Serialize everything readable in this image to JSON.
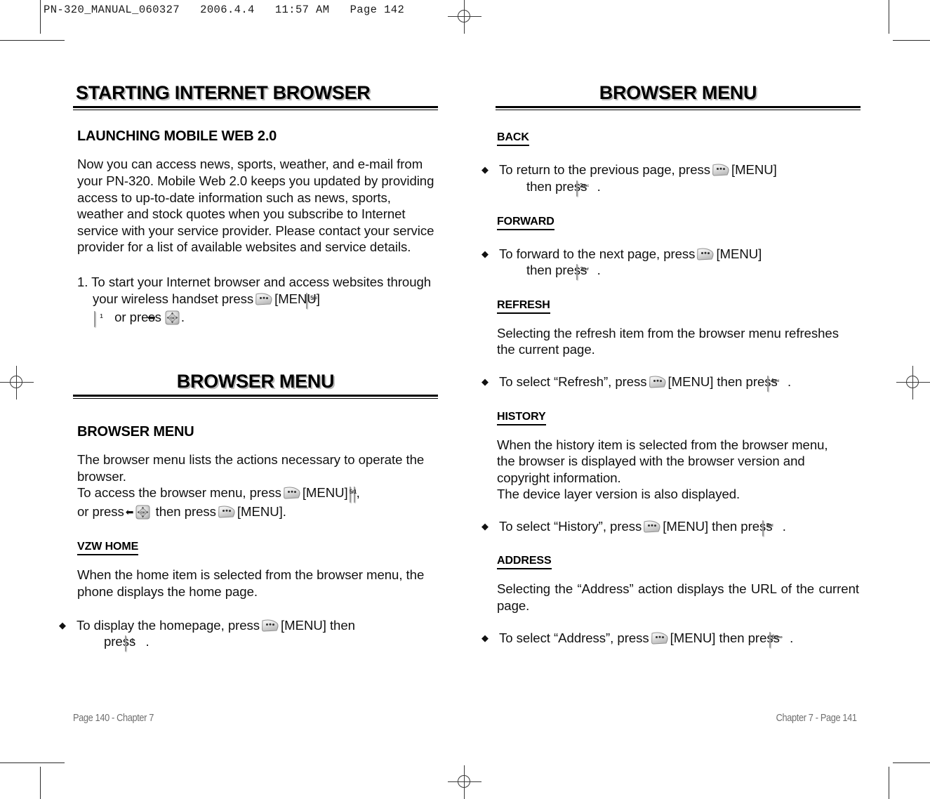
{
  "print_slug": "PN-320_MANUAL_060327   2006.4.4   11:57 AM   Page 142",
  "left_column": {
    "banner": "STARTING INTERNET BROWSER",
    "section_heading": "LAUNCHING MOBILE WEB 2.0",
    "intro_paragraph": "Now you can access news, sports, weather, and e-mail from your PN-320.  Mobile Web 2.0 keeps you updated by providing access to up-to-date information such as news, sports, weather and stock quotes when you subscribe to Internet service with your service provider. Please contact your service provider for a list of available websites and service details.",
    "step_1_a": "1. To start your Internet browser and access websites through your wireless handset press",
    "step_1_menu": "[MENU]",
    "step_1_b": "or press",
    "step_1_end": ".",
    "banner_2": "BROWSER MENU",
    "section_heading_2": "BROWSER MENU",
    "menu_para_line1": "The browser menu lists the actions necessary to operate the browser.",
    "menu_para_line2_a": "To access the browser menu, press",
    "menu_para_line2_menu": "[MENU]",
    "menu_para_line2_comma": ",",
    "menu_para_line3_a": "or press",
    "menu_para_line3_b": "then press",
    "menu_para_line3_menu": "[MENU].",
    "vzw_home_heading": "VZW HOME",
    "vzw_home_para": "When the home item is selected from the browser menu, the phone displays the home page.",
    "vzw_home_bullet_a": "To display the homepage, press",
    "vzw_home_bullet_menu": "[MENU] then",
    "vzw_home_bullet_b": "press",
    "vzw_home_bullet_end": "."
  },
  "right_column": {
    "banner": "BROWSER MENU",
    "back": {
      "heading": "BACK",
      "bullet_a": "To return to the previous page, press",
      "bullet_menu": "[MENU]",
      "bullet_b": "then press",
      "bullet_end": "."
    },
    "forward": {
      "heading": "FORWARD",
      "bullet_a": "To forward to the next page, press",
      "bullet_menu": "[MENU]",
      "bullet_b": "then press",
      "bullet_end": "."
    },
    "refresh": {
      "heading": "REFRESH",
      "para": "Selecting the refresh item from the browser menu refreshes the current page.",
      "bullet_a": "To select “Refresh”, press",
      "bullet_menu": "[MENU] then press",
      "bullet_end": "."
    },
    "history": {
      "heading": "HISTORY",
      "para_line1": "When the history item is selected from the browser menu, the browser is displayed with the browser version and copyright information.",
      "para_line2": "The device layer version is also displayed.",
      "bullet_a": "To select “History”, press",
      "bullet_menu": "[MENU] then press",
      "bullet_end": "."
    },
    "address": {
      "heading": "ADDRESS",
      "para": "Selecting the “Address” action displays the URL of the current page.",
      "bullet_a": "To select “Address”, press",
      "bullet_menu": "[MENU] then press",
      "bullet_end": "."
    }
  },
  "keys": {
    "k1": {
      "digit": "1",
      "letters": ""
    },
    "k2": {
      "digit": "2",
      "letters": "abc"
    },
    "k3": {
      "digit": "3",
      "letters": "def"
    },
    "k4": {
      "digit": "4",
      "letters": "ghi"
    },
    "k5": {
      "digit": "5",
      "letters": "jkl"
    },
    "k6": {
      "digit": "6",
      "letters": "mno"
    }
  },
  "footer": {
    "left": "Page 140 - Chapter 7",
    "right": "Chapter 7 - Page 141"
  }
}
